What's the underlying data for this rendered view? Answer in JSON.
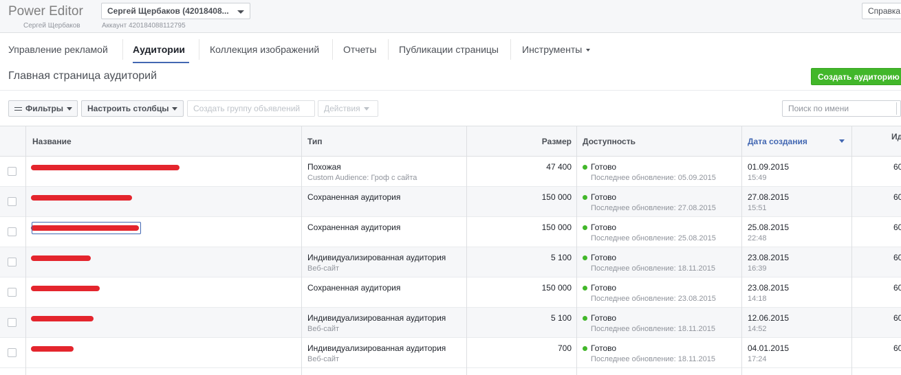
{
  "header": {
    "app_title": "Power Editor",
    "user_name": "Сергей Щербаков",
    "account_select": "Сергей Щербаков (42018408...",
    "account_label": "Аккаунт 420184088112795",
    "help_label": "Справка"
  },
  "nav": {
    "tabs": [
      {
        "label": "Управление рекламой"
      },
      {
        "label": "Аудитории",
        "active": true
      },
      {
        "label": "Коллекция изображений"
      },
      {
        "label": "Отчеты"
      },
      {
        "label": "Публикации страницы"
      },
      {
        "label": "Инструменты"
      }
    ]
  },
  "page": {
    "title": "Главная страница аудиторий",
    "create_button": "Создать аудиторию"
  },
  "toolbar": {
    "filters": "Фильтры",
    "columns": "Настроить столбцы",
    "create_group": "Создать группу объявлений",
    "actions": "Действия",
    "search_placeholder": "Поиск по имени"
  },
  "table": {
    "columns": {
      "name": "Название",
      "type": "Тип",
      "size": "Размер",
      "availability": "Доступность",
      "created": "Дата создания",
      "id": "Ид"
    },
    "accent_color": "#4267b2",
    "status_color": "#42b72a",
    "redaction_color": "#e4252d",
    "rows": [
      {
        "type": "Похожая",
        "type_sub": "Custom Audience: Гроф с сайта",
        "size": "47 400",
        "status": "Готово",
        "status_sub": "Последнее обновление: 05.09.2015",
        "date": "01.09.2015",
        "time": "15:49",
        "id": "60"
      },
      {
        "type": "Сохраненная аудитория",
        "type_sub": "",
        "size": "150 000",
        "status": "Готово",
        "status_sub": "Последнее обновление: 27.08.2015",
        "date": "27.08.2015",
        "time": "15:51",
        "id": "60"
      },
      {
        "type": "Сохраненная аудитория",
        "type_sub": "",
        "size": "150 000",
        "status": "Готово",
        "status_sub": "Последнее обновление: 25.08.2015",
        "date": "25.08.2015",
        "time": "22:48",
        "id": "60"
      },
      {
        "type": "Индивидуализированная аудитория",
        "type_sub": "Веб-сайт",
        "size": "5 100",
        "status": "Готово",
        "status_sub": "Последнее обновление: 18.11.2015",
        "date": "23.08.2015",
        "time": "16:39",
        "id": "60"
      },
      {
        "type": "Сохраненная аудитория",
        "type_sub": "",
        "size": "150 000",
        "status": "Готово",
        "status_sub": "Последнее обновление: 23.08.2015",
        "date": "23.08.2015",
        "time": "14:18",
        "id": "60"
      },
      {
        "type": "Индивидуализированная аудитория",
        "type_sub": "Веб-сайт",
        "size": "5 100",
        "status": "Готово",
        "status_sub": "Последнее обновление: 18.11.2015",
        "date": "12.06.2015",
        "time": "14:52",
        "id": "60"
      },
      {
        "type": "Индивидуализированная аудитория",
        "type_sub": "Веб-сайт",
        "size": "700",
        "status": "Готово",
        "status_sub": "Последнее обновление: 18.11.2015",
        "date": "04.01.2015",
        "time": "17:24",
        "id": "60"
      }
    ]
  }
}
